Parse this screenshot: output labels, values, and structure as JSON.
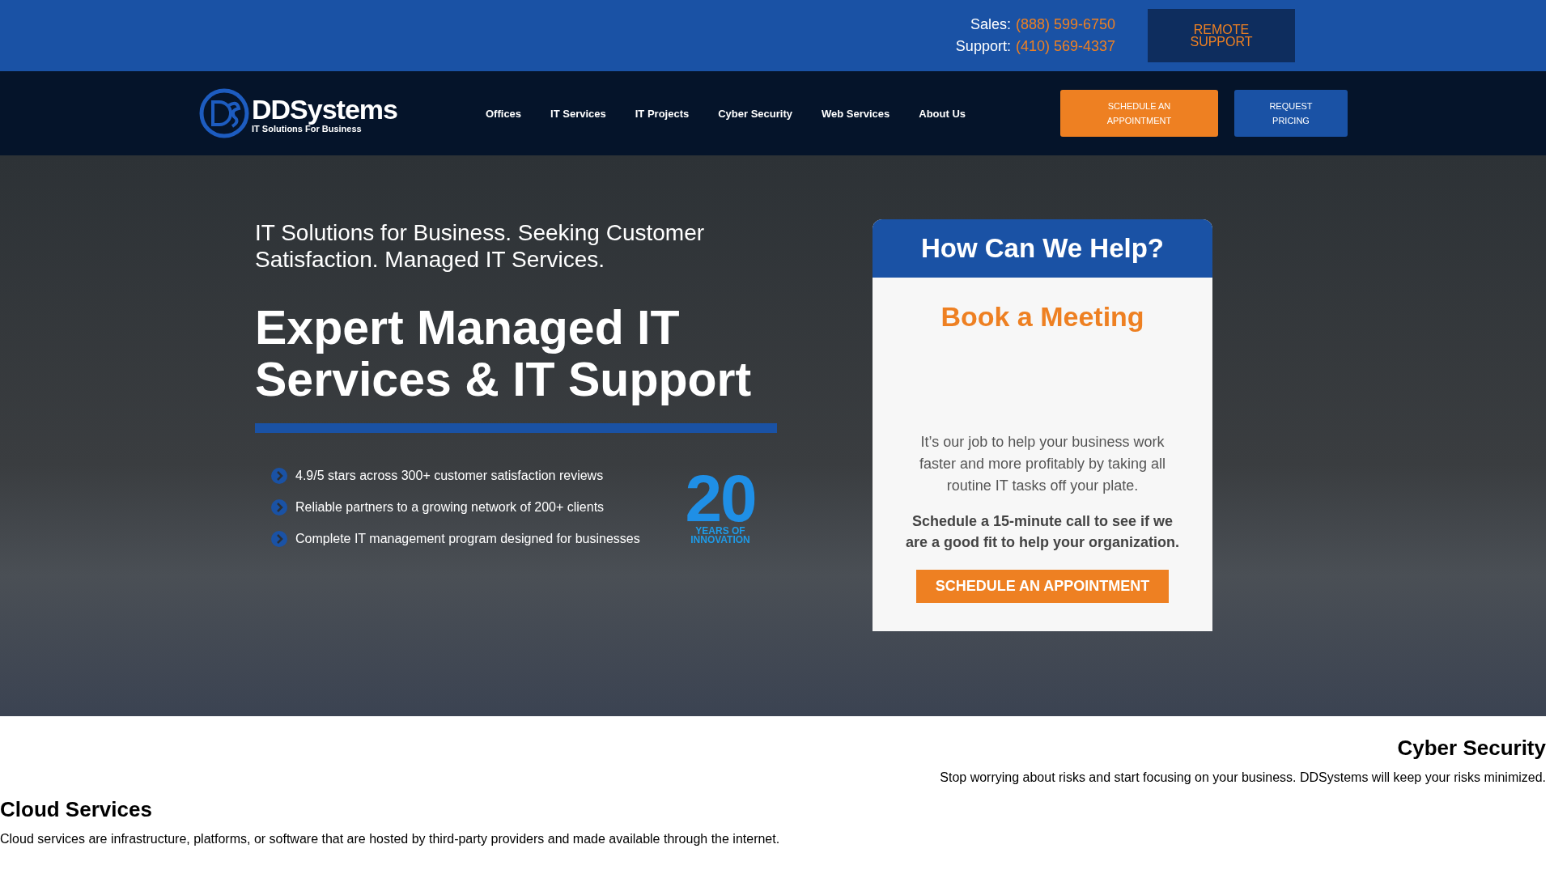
{
  "top_bar": {
    "contacts": [
      {
        "label": "Sales:",
        "phone": "(888) 599-6750"
      },
      {
        "label": "Support:",
        "phone": "(410) 569-4337"
      }
    ],
    "remote_button": "REMOTE SUPPORT"
  },
  "header": {
    "logo": {
      "name": "DDSystems",
      "tagline": "IT Solutions For Business"
    },
    "nav": [
      "Offices",
      "IT Services",
      "IT Projects",
      "Cyber Security",
      "Web Services",
      "About Us"
    ],
    "buttons": [
      {
        "kind": "primary",
        "label": "SCHEDULE AN APPOINTMENT"
      },
      {
        "kind": "secondary",
        "label": "REQUEST PRICING"
      }
    ]
  },
  "hero": {
    "subtitle": "IT Solutions for Business. Seeking Customer Satisfaction. Managed IT Services.",
    "title": "Expert Managed IT Services & IT Support",
    "points": [
      "4.9/5 stars across 300+ customer satisfaction reviews",
      "Reliable partners to a growing network of 200+ clients",
      "Complete IT management program designed for businesses"
    ],
    "badge": {
      "number": "20",
      "caption": "YEARS OF INNOVATION"
    }
  },
  "help_card": {
    "title": "How Can We Help?",
    "subtitle": "Book a Meeting",
    "text": "It’s our job to help your business work faster and more profitably by taking all routine IT tasks off your plate.",
    "bold_text": "Schedule a 15-minute call to see if we are a good fit to help your organization.",
    "button": "SCHEDULE AN APPOINTMENT"
  },
  "sections": [
    {
      "kind": "aside",
      "title": "Cyber Security",
      "text": "Stop worrying about risks and start focusing on your business. DDSystems will keep your risks minimized."
    },
    {
      "kind": "main",
      "title": "Cloud Services",
      "text": "Cloud services are infrastructure, platforms, or software that are hosted by third-party providers and made available through the internet."
    }
  ]
}
